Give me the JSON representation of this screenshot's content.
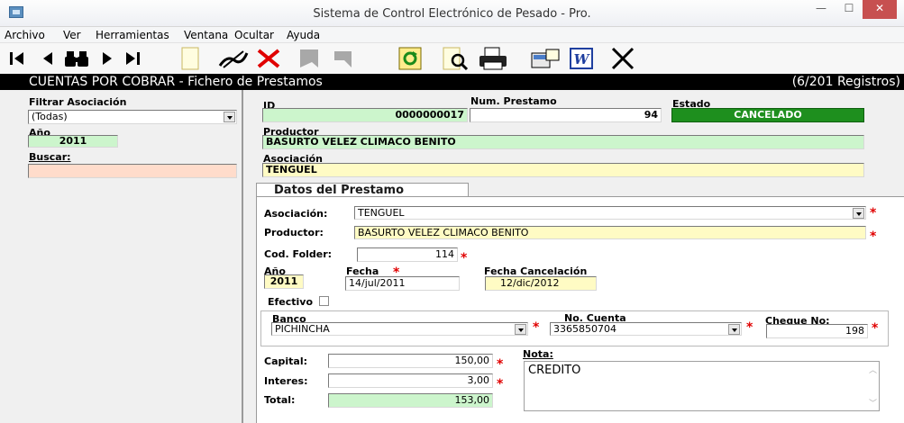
{
  "window": {
    "title": "Sistema de Control Electrónico de Pesado - Pro.",
    "min": "—",
    "max": "☐",
    "close": "✕"
  },
  "menu": [
    {
      "label": "Archivo"
    },
    {
      "label": "Ver"
    },
    {
      "label": "Herramientas"
    },
    {
      "label": "Ventana"
    },
    {
      "label": "Ocultar"
    },
    {
      "label": "Ayuda"
    }
  ],
  "toolbar": {
    "icons": [
      "first-record-icon",
      "prev-record-icon",
      "find-binoculars-icon",
      "next-record-icon",
      "last-record-icon",
      "new-document-icon",
      "edit-pen-icon",
      "delete-x-icon",
      "save-disabled-icon",
      "undo-disabled-icon",
      "refresh-icon",
      "preview-icon",
      "print-icon",
      "export-icon",
      "word-icon",
      "close-x-icon"
    ],
    "word_letter": "W"
  },
  "header": {
    "title": "CUENTAS POR COBRAR - Fichero de Prestamos",
    "count": "(6/201 Registros)"
  },
  "left": {
    "filtrar_label": "Filtrar Asociación",
    "filtrar_value": "(Todas)",
    "anio_label": "Año",
    "anio_value": "2011",
    "buscar_label": "Buscar:",
    "buscar_value": ""
  },
  "record": {
    "id_label": "ID",
    "id_value": "0000000017",
    "num_label": "Num. Prestamo",
    "num_value": "94",
    "estado_label": "Estado",
    "estado_value": "CANCELADO",
    "productor_label": "Productor",
    "productor_value": "BASURTO VELEZ CLIMACO BENITO",
    "asociacion_label": "Asociación",
    "asociacion_value": "TENGUEL"
  },
  "tab": {
    "label": "Datos del Prestamo"
  },
  "form": {
    "asociacion_label": "Asociación:",
    "asociacion_value": "TENGUEL",
    "productor_label": "Productor:",
    "productor_value": "BASURTO VELEZ CLIMACO BENITO",
    "folder_label": "Cod. Folder:",
    "folder_value": "114",
    "anio_label": "Año",
    "anio_value": "2011",
    "fecha_label": "Fecha",
    "fecha_value": "14/jul/2011",
    "fecha_canc_label": "Fecha Cancelación",
    "fecha_canc_value": "12/dic/2012",
    "efectivo_label": "Efectivo",
    "banco_label": "Banco",
    "banco_value": "PICHINCHA",
    "cuenta_label": "No. Cuenta",
    "cuenta_value": "3365850704",
    "cheque_label": "Cheque No:",
    "cheque_value": "198",
    "capital_label": "Capital:",
    "capital_value": "150,00",
    "interes_label": "Interes:",
    "interes_value": "3,00",
    "total_label": "Total:",
    "total_value": "153,00",
    "nota_label": "Nota:",
    "nota_value": "CREDITO",
    "required": "*"
  },
  "colors": {
    "green_field": "#ccf5cc",
    "yellow_field": "#fffbc4",
    "estado_bg": "#1e8f1e",
    "header_bg": "#000000",
    "required": "#e00000"
  }
}
